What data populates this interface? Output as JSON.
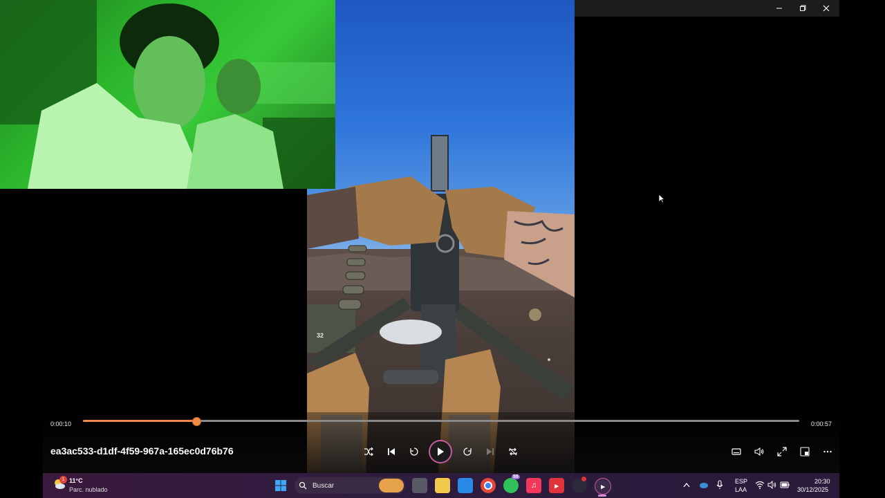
{
  "player": {
    "window_controls": [
      "minimize",
      "restore",
      "close"
    ],
    "position": "0:00:10",
    "duration": "0:00:57",
    "progress": 0.1583,
    "file_name": "ea3ac533-d1df-4f59-967a-165ec0d76b76",
    "controls": [
      "shuffle",
      "previous",
      "rewind-10",
      "play",
      "forward-30",
      "next",
      "repeat-off"
    ],
    "right_controls": [
      "subtitles",
      "volume",
      "fullscreen",
      "mini-player",
      "more"
    ],
    "accent": "#f08a45"
  },
  "video": {
    "ammo_box_number": "32"
  },
  "taskbar": {
    "weather": {
      "temp": "11°C",
      "desc": "Parc. nublado",
      "alerts": "1"
    },
    "search_label": "Buscar",
    "whatsapp_badge": "55",
    "language_top": "ESP",
    "language_bottom": "LAA",
    "time": "20:30",
    "date": "30/12/2025",
    "pinned_apps": [
      "start-icon",
      "search-icon",
      "news-icon",
      "task-view-icon",
      "file-explorer-icon",
      "store-icon",
      "chrome-icon",
      "whatsapp-icon",
      "music-icon",
      "recorder-icon",
      "steam-icon",
      "media-player-icon"
    ]
  }
}
